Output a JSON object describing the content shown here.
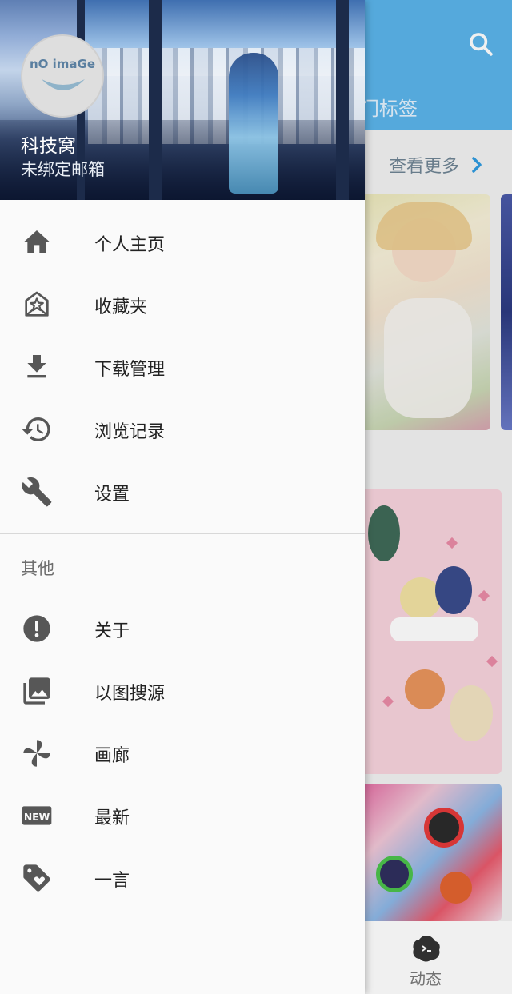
{
  "background_app": {
    "tab_partial_label": "门标签",
    "see_more_label": "查看更多",
    "bottom_tab_label": "动态",
    "accent_color": "#5bb4ea"
  },
  "drawer": {
    "user": {
      "name": "科技窝",
      "email_status": "未绑定邮箱",
      "avatar_placeholder": "nO imaGe"
    },
    "main_items": [
      {
        "icon": "home-icon",
        "label": "个人主页"
      },
      {
        "icon": "favorites-icon",
        "label": "收藏夹"
      },
      {
        "icon": "download-icon",
        "label": "下载管理"
      },
      {
        "icon": "history-icon",
        "label": "浏览记录"
      },
      {
        "icon": "wrench-icon",
        "label": "设置"
      }
    ],
    "other_section_title": "其他",
    "other_items": [
      {
        "icon": "info-icon",
        "label": "关于"
      },
      {
        "icon": "image-search-icon",
        "label": "以图搜源"
      },
      {
        "icon": "pinwheel-icon",
        "label": "画廊"
      },
      {
        "icon": "new-badge-icon",
        "label": "最新"
      },
      {
        "icon": "tag-heart-icon",
        "label": "一言"
      }
    ]
  }
}
